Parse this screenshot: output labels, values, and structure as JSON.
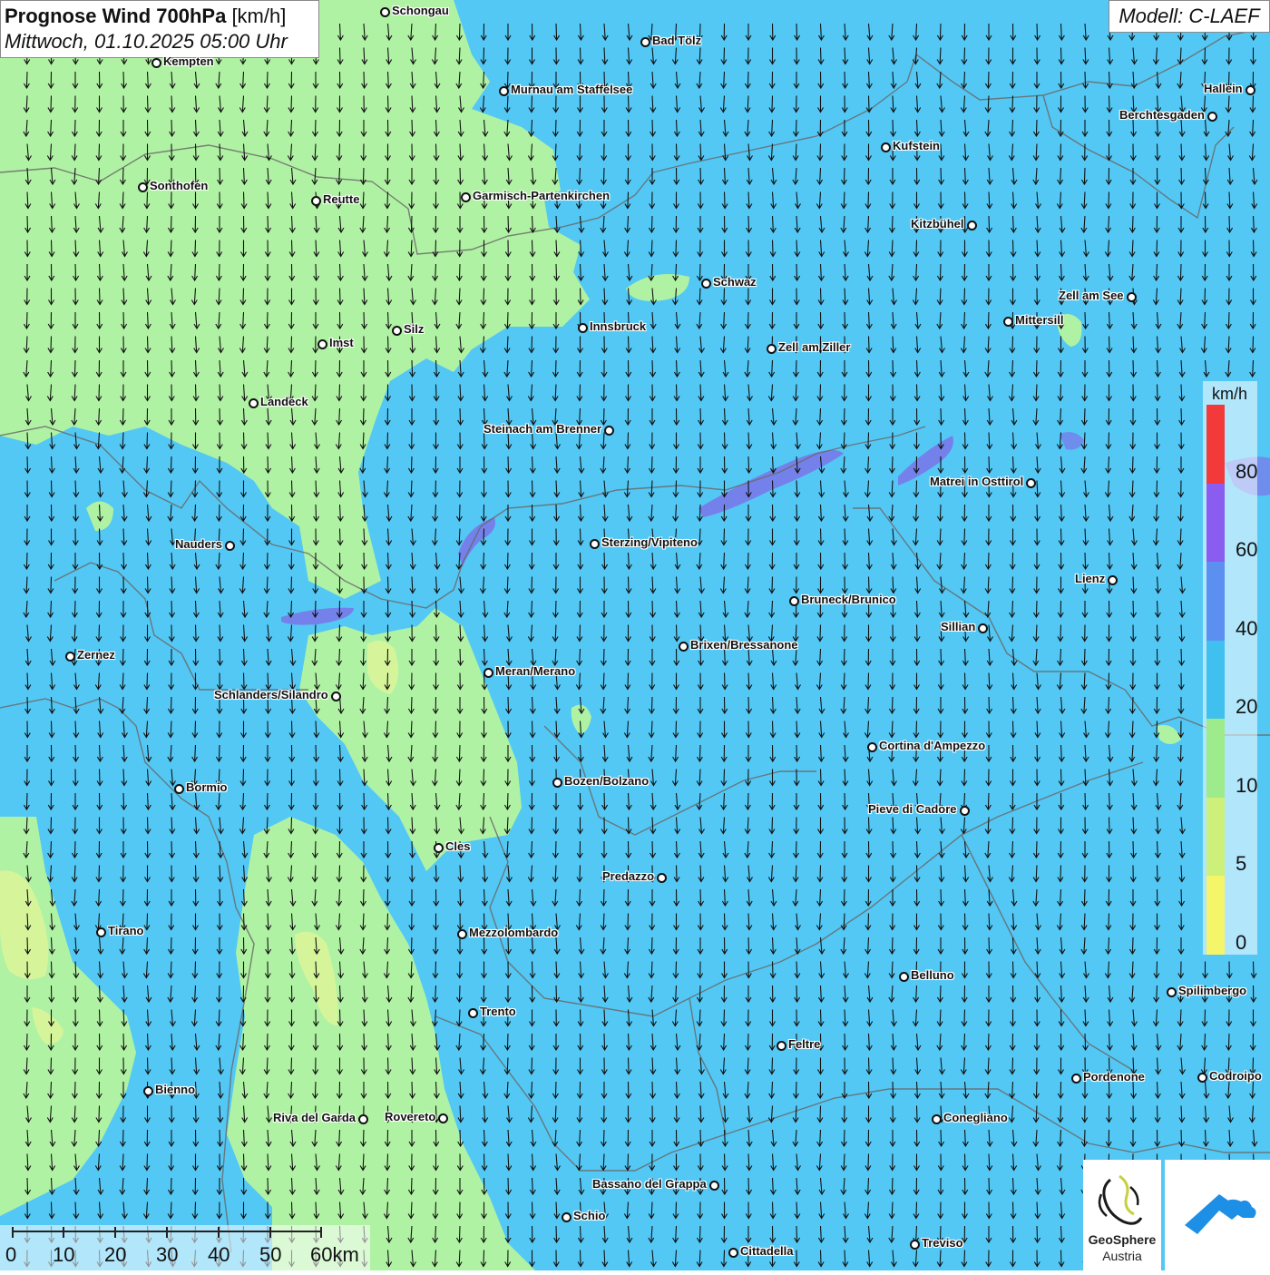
{
  "header": {
    "title_bold": "Prognose Wind 700hPa",
    "title_unit": "[km/h]",
    "datetime": "Mittwoch, 01.10.2025 05:00 Uhr",
    "model": "Modell: C-LAEF"
  },
  "colors": {
    "ocean_blue": "#53c8f5",
    "green": "#b0f2a3",
    "yellow_green": "#d6f59a",
    "purple": "#8a6ee8",
    "arrow": "#111111",
    "border": "#6a6a6a"
  },
  "legend": {
    "unit": "km/h",
    "ticks": [
      "0",
      "5",
      "10",
      "20",
      "40",
      "60",
      "80"
    ],
    "segments": [
      {
        "from": 0,
        "to": 5,
        "color": "#f5f56a"
      },
      {
        "from": 5,
        "to": 10,
        "color": "#cdf07a"
      },
      {
        "from": 10,
        "to": 20,
        "color": "#9deb8a"
      },
      {
        "from": 20,
        "to": 40,
        "color": "#3fc0ee"
      },
      {
        "from": 40,
        "to": 60,
        "color": "#5b8ff0"
      },
      {
        "from": 60,
        "to": 80,
        "color": "#8a5cf0"
      },
      {
        "from": 80,
        "to": 100,
        "color": "#f23a3a"
      }
    ]
  },
  "scale": {
    "labels": [
      "0",
      "10",
      "20",
      "30",
      "40",
      "50",
      "60km"
    ]
  },
  "cities": [
    {
      "name": "Schongau"
    },
    {
      "name": "Kempten"
    },
    {
      "name": "Bad Tölz"
    },
    {
      "name": "Murnau am Staffelsee"
    },
    {
      "name": "Hallein"
    },
    {
      "name": "Berchtesgaden"
    },
    {
      "name": "Kufstein"
    },
    {
      "name": "Sonthofen"
    },
    {
      "name": "Reutte"
    },
    {
      "name": "Garmisch-Partenkirchen"
    },
    {
      "name": "Kitzbühel"
    },
    {
      "name": "Schwaz"
    },
    {
      "name": "Zell am See"
    },
    {
      "name": "Mittersill"
    },
    {
      "name": "Innsbruck"
    },
    {
      "name": "Silz"
    },
    {
      "name": "Imst"
    },
    {
      "name": "Zell am Ziller"
    },
    {
      "name": "Landeck"
    },
    {
      "name": "Steinach am Brenner"
    },
    {
      "name": "Matrei in Osttirol"
    },
    {
      "name": "Nauders"
    },
    {
      "name": "Sterzing/Vipiteno"
    },
    {
      "name": "Lienz"
    },
    {
      "name": "Bruneck/Brunico"
    },
    {
      "name": "Sillian"
    },
    {
      "name": "Zernez"
    },
    {
      "name": "Brixen/Bressanone"
    },
    {
      "name": "Meran/Merano"
    },
    {
      "name": "Schlanders/Silandro"
    },
    {
      "name": "Cortina d'Ampezzo"
    },
    {
      "name": "Bozen/Bolzano"
    },
    {
      "name": "Bormio"
    },
    {
      "name": "Pieve di Cadore"
    },
    {
      "name": "Cles"
    },
    {
      "name": "Predazzo"
    },
    {
      "name": "Tirano"
    },
    {
      "name": "Mezzolombardo"
    },
    {
      "name": "Belluno"
    },
    {
      "name": "Spilimbergo"
    },
    {
      "name": "Trento"
    },
    {
      "name": "Feltre"
    },
    {
      "name": "Bienno"
    },
    {
      "name": "Pordenone"
    },
    {
      "name": "Codroipo"
    },
    {
      "name": "Riva del Garda"
    },
    {
      "name": "Rovereto"
    },
    {
      "name": "Conegliano"
    },
    {
      "name": "Bassano del Grappa"
    },
    {
      "name": "Schio"
    },
    {
      "name": "Treviso"
    },
    {
      "name": "Cittadella"
    }
  ],
  "logos": {
    "geosphere_line1": "GeoSphere",
    "geosphere_line2": "Austria",
    "geosphere_icon": "geosphere-logo-icon",
    "app_icon": "cloud-arrow-logo-icon"
  }
}
